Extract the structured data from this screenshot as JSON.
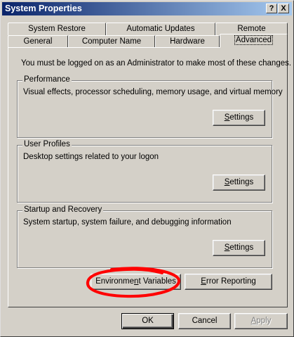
{
  "window": {
    "title": "System Properties",
    "help_button": "?",
    "close_button": "X"
  },
  "tabs": {
    "back_row": [
      "System Restore",
      "Automatic Updates",
      "Remote"
    ],
    "front_row": [
      "General",
      "Computer Name",
      "Hardware",
      "Advanced"
    ],
    "active": "Advanced"
  },
  "advanced": {
    "intro": "You must be logged on as an Administrator to make most of these changes.",
    "performance": {
      "title": "Performance",
      "description": "Visual effects, processor scheduling, memory usage, and virtual memory",
      "button": {
        "mnemonic": "S",
        "rest": "ettings"
      }
    },
    "user_profiles": {
      "title": "User Profiles",
      "description": "Desktop settings related to your logon",
      "button": {
        "mnemonic": "S",
        "rest": "ettings"
      }
    },
    "startup_recovery": {
      "title": "Startup and Recovery",
      "description": "System startup, system failure, and debugging information",
      "button": {
        "mnemonic": "S",
        "rest": "ettings"
      }
    },
    "environment_variables": {
      "before": "Environme",
      "mnemonic": "n",
      "after": "t Variables"
    },
    "error_reporting": {
      "mnemonic": "E",
      "rest": "rror Reporting"
    }
  },
  "footer": {
    "ok": "OK",
    "cancel": "Cancel",
    "apply": {
      "mnemonic": "A",
      "rest": "pply"
    }
  },
  "colors": {
    "face": "#d4d0c8",
    "title_start": "#0a246a",
    "title_end": "#a6caf0",
    "annotation": "#ff0000"
  }
}
